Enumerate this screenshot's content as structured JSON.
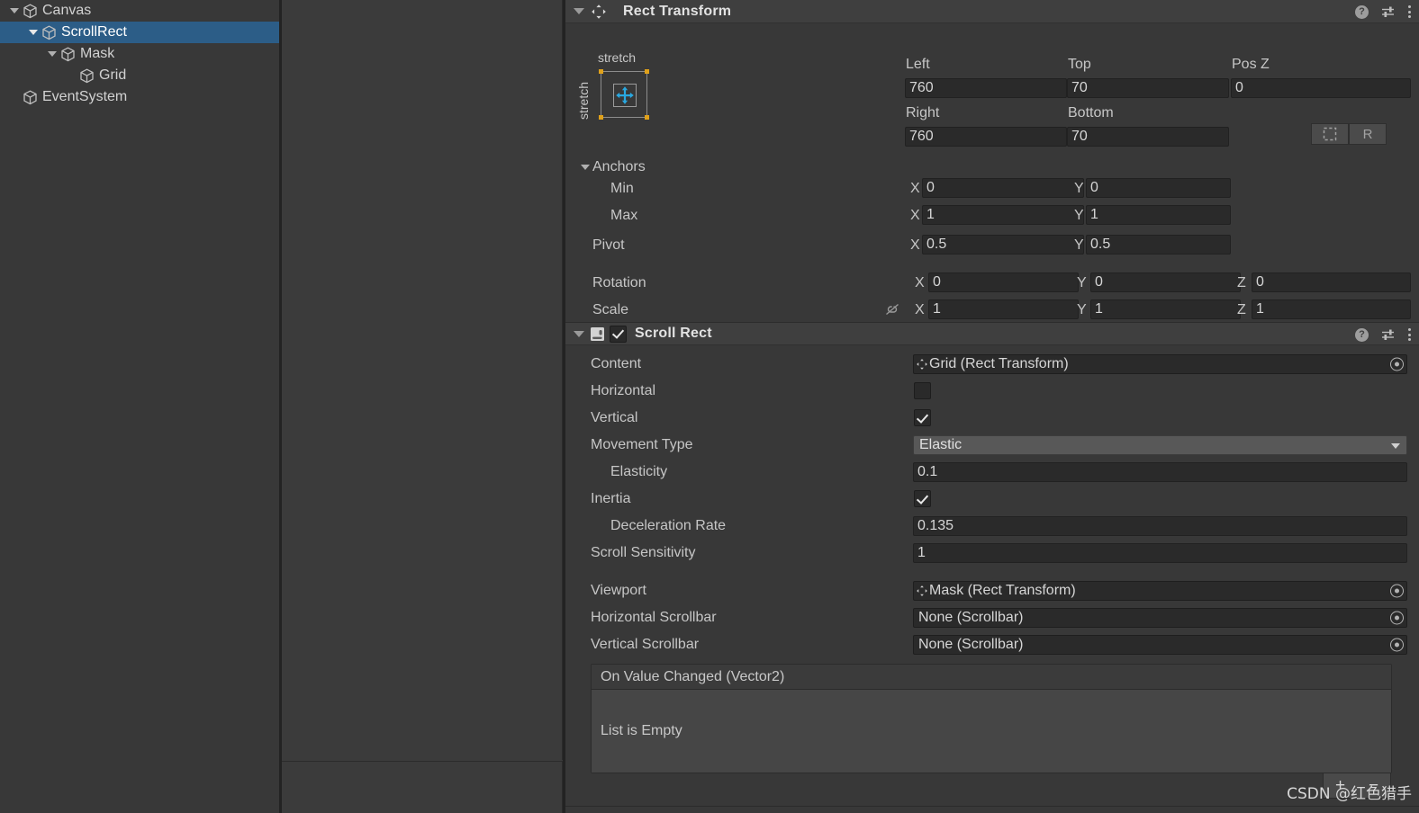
{
  "hierarchy": {
    "items": [
      {
        "label": "Canvas",
        "depth": 0,
        "expanded": true,
        "selected": false,
        "icon": "cube-icon"
      },
      {
        "label": "ScrollRect",
        "depth": 1,
        "expanded": true,
        "selected": true,
        "icon": "cube-icon"
      },
      {
        "label": "Mask",
        "depth": 2,
        "expanded": true,
        "selected": false,
        "icon": "cube-icon"
      },
      {
        "label": "Grid",
        "depth": 3,
        "expanded": false,
        "selected": false,
        "icon": "cube-icon"
      },
      {
        "label": "EventSystem",
        "depth": 0,
        "expanded": false,
        "selected": false,
        "icon": "cube-icon"
      }
    ]
  },
  "inspector": {
    "rect_transform": {
      "title": "Rect Transform",
      "help_icon": "?",
      "anchor_preset": {
        "top_label": "stretch",
        "left_label": "stretch"
      },
      "labels": {
        "left": "Left",
        "top": "Top",
        "pos_z": "Pos Z",
        "right": "Right",
        "bottom": "Bottom",
        "anchors": "Anchors",
        "min": "Min",
        "max": "Max",
        "pivot": "Pivot",
        "rotation": "Rotation",
        "scale": "Scale"
      },
      "values": {
        "left": "760",
        "top": "70",
        "pos_z": "0",
        "right": "760",
        "bottom": "70",
        "anchor_min_x": "0",
        "anchor_min_y": "0",
        "anchor_max_x": "1",
        "anchor_max_y": "1",
        "pivot_x": "0.5",
        "pivot_y": "0.5",
        "rotation_x": "0",
        "rotation_y": "0",
        "rotation_z": "0",
        "scale_x": "1",
        "scale_y": "1",
        "scale_z": "1"
      },
      "axis": {
        "x": "X",
        "y": "Y",
        "z": "Z"
      },
      "raw_button_label": "R"
    },
    "scroll_rect": {
      "title": "Scroll Rect",
      "enabled": true,
      "help_icon": "?",
      "rows": [
        {
          "label": "Content",
          "type": "object",
          "value": "Grid (Rect Transform)",
          "indent": 0
        },
        {
          "label": "Horizontal",
          "type": "checkbox",
          "value": false,
          "indent": 0
        },
        {
          "label": "Vertical",
          "type": "checkbox",
          "value": true,
          "indent": 0
        },
        {
          "label": "Movement Type",
          "type": "dropdown",
          "value": "Elastic",
          "indent": 0
        },
        {
          "label": "Elasticity",
          "type": "text",
          "value": "0.1",
          "indent": 1
        },
        {
          "label": "Inertia",
          "type": "checkbox",
          "value": true,
          "indent": 0
        },
        {
          "label": "Deceleration Rate",
          "type": "text",
          "value": "0.135",
          "indent": 1
        },
        {
          "label": "Scroll Sensitivity",
          "type": "text",
          "value": "1",
          "indent": 0
        },
        {
          "label": "Viewport",
          "type": "object",
          "value": "Mask (Rect Transform)",
          "indent": 0
        },
        {
          "label": "Horizontal Scrollbar",
          "type": "object",
          "value": "None (Scrollbar)",
          "indent": 0
        },
        {
          "label": "Vertical Scrollbar",
          "type": "object",
          "value": "None (Scrollbar)",
          "indent": 0
        }
      ],
      "event_list": {
        "header": "On Value Changed (Vector2)",
        "empty_text": "List is Empty",
        "add_label": "+",
        "remove_label": "−"
      }
    }
  },
  "watermark": "CSDN @红色猎手",
  "colors": {
    "panel_bg": "#383838",
    "header_bg": "#3f3f3f",
    "selection_blue": "#2c5d87",
    "field_bg": "#2a2a2a",
    "dropdown_bg": "#585858",
    "anchor_handle": "#e0a11a",
    "anchor_arrow": "#29a8e0"
  }
}
